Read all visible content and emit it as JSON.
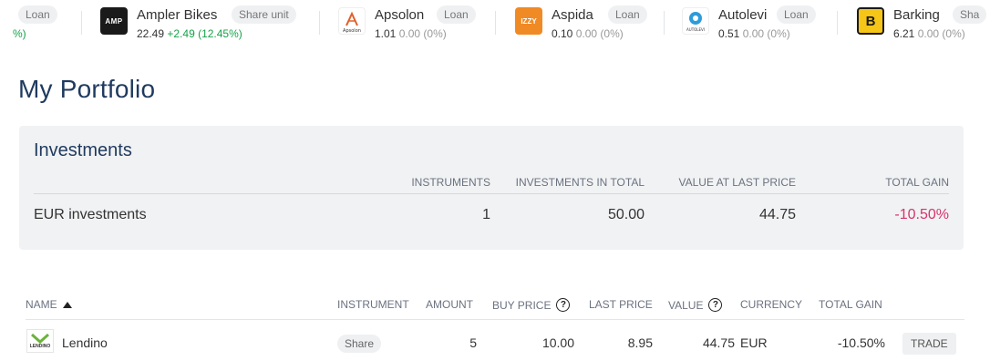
{
  "ticker": {
    "partial": {
      "badge": "Loan",
      "change": "%)"
    },
    "items": [
      {
        "name": "Ampler Bikes",
        "badge": "Share unit",
        "price": "22.49",
        "change": "+2.49 (12.45%)",
        "logo_text": "AMP",
        "logo_color": "#1a1a1a"
      },
      {
        "name": "Apsolon",
        "badge": "Loan",
        "price": "1.01",
        "change": "0.00 (0%)",
        "logo_text": "Apsolon",
        "logo_color": "#ffffff"
      },
      {
        "name": "Aspida",
        "badge": "Loan",
        "price": "0.10",
        "change": "0.00 (0%)",
        "logo_text": "IZZY",
        "logo_color": "#f08a24"
      },
      {
        "name": "Autolevi",
        "badge": "Loan",
        "price": "0.51",
        "change": "0.00 (0%)",
        "logo_text": "AUTOLEVI",
        "logo_color": "#ffffff"
      },
      {
        "name": "Barking",
        "badge": "Sha",
        "price": "6.21",
        "change": "0.00 (0%)",
        "logo_text": "B",
        "logo_color": "#f5c518"
      }
    ]
  },
  "page_title": "My Portfolio",
  "investments": {
    "title": "Investments",
    "headers": [
      "INSTRUMENTS",
      "INVESTMENTS IN TOTAL",
      "VALUE AT LAST PRICE",
      "TOTAL GAIN"
    ],
    "row": {
      "label": "EUR investments",
      "instruments": "1",
      "total": "50.00",
      "value": "44.75",
      "gain": "-10.50%"
    }
  },
  "holdings": {
    "headers": {
      "name": "NAME",
      "instrument": "INSTRUMENT",
      "amount": "AMOUNT",
      "buy_price": "BUY PRICE",
      "last_price": "LAST PRICE",
      "value": "VALUE",
      "currency": "CURRENCY",
      "total_gain": "TOTAL GAIN"
    },
    "rows": [
      {
        "name": "Lendino",
        "logo_text": "LENDINO",
        "instrument": "Share",
        "amount": "5",
        "buy_price": "10.00",
        "last_price": "8.95",
        "value": "44.75",
        "currency": "EUR",
        "total_gain": "-10.50%",
        "action": "TRADE"
      }
    ]
  },
  "colors": {
    "accent": "#1f3a5f",
    "positive": "#16a34a",
    "negative": "#d6336c"
  }
}
